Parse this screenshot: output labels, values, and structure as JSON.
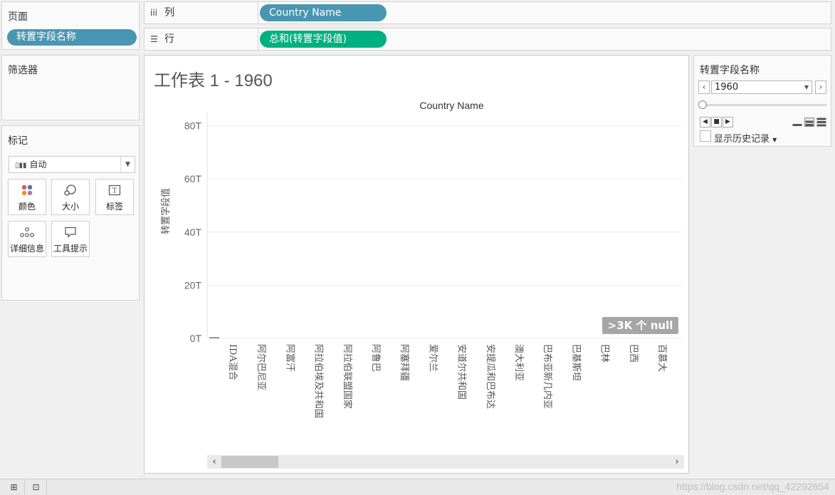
{
  "pages_panel": {
    "title": "页面",
    "pill": "转置字段名称"
  },
  "columns_shelf": {
    "icon": "iii",
    "label": "列",
    "pill": "Country Name"
  },
  "rows_shelf": {
    "icon": "☰",
    "label": "行",
    "pill": "总和(转置字段值)"
  },
  "filters_panel": {
    "title": "筛选器"
  },
  "marks_panel": {
    "title": "标记",
    "mark_type": "自动",
    "buttons": [
      {
        "label": "颜色",
        "icon": "color-icon"
      },
      {
        "label": "大小",
        "icon": "size-icon"
      },
      {
        "label": "标签",
        "icon": "label-icon"
      },
      {
        "label": "详细信息",
        "icon": "detail-icon"
      },
      {
        "label": "工具提示",
        "icon": "tooltip-icon"
      }
    ]
  },
  "sheet": {
    "title": "工作表 1 - 1960",
    "null_badge": ">3K 个 null"
  },
  "chart_data": {
    "type": "bar",
    "title": "Country Name",
    "xlabel": "Country Name",
    "ylabel": "转置字段值",
    "y_ticks": [
      "80T",
      "60T",
      "40T",
      "20T",
      "0T"
    ],
    "ylim": [
      0,
      85
    ],
    "y_unit": "T",
    "categories": [
      "IDA混合",
      "阿尔巴尼亚",
      "阿富汗",
      "阿拉伯埃及共和国",
      "阿拉伯联盟国家",
      "阿鲁巴",
      "阿塞拜疆",
      "爱尔兰",
      "安道尔共和国",
      "安提瓜和巴布达",
      "澳大利亚",
      "巴布亚新几内亚",
      "巴基斯坦",
      "巴林",
      "巴西",
      "百慕大"
    ],
    "values": [
      0.05,
      0,
      0,
      0,
      0,
      0,
      0,
      0,
      0,
      0,
      0,
      0,
      0,
      0,
      0,
      0
    ],
    "grid": true,
    "bar_color": "#4e79a7"
  },
  "filter_card": {
    "title": "转置字段名称",
    "selected": "1960",
    "show_history": "显示历史记录"
  },
  "watermark": "https://blog.csdn.net/qq_42292654"
}
